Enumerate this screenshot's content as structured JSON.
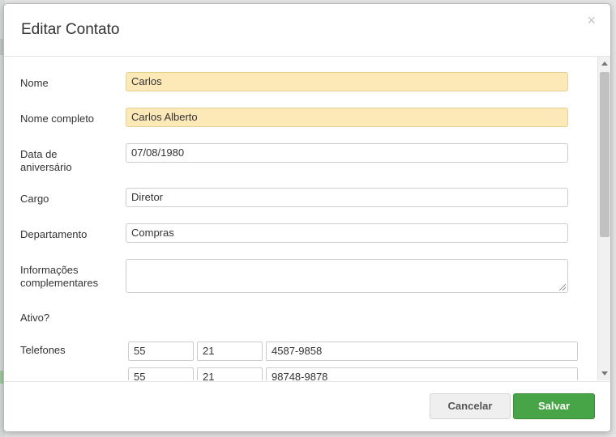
{
  "dialog": {
    "title": "Editar Contato",
    "close_glyph": "×"
  },
  "form": {
    "nome": {
      "label": "Nome",
      "value": "Carlos"
    },
    "nome_completo": {
      "label": "Nome completo",
      "value": "Carlos Alberto"
    },
    "aniversario": {
      "label_line1": "Data de",
      "label_line2": "aniversário",
      "value": "07/08/1980"
    },
    "cargo": {
      "label": "Cargo",
      "value": "Diretor"
    },
    "departamento": {
      "label": "Departamento",
      "value": "Compras"
    },
    "informacoes": {
      "label_line1": "Informações",
      "label_line2": "complementares",
      "value": ""
    },
    "ativo": {
      "label": "Ativo?"
    },
    "telefones": {
      "label": "Telefones",
      "rows": [
        {
          "country": "55",
          "area": "21",
          "number": "4587-9858"
        },
        {
          "country": "55",
          "area": "21",
          "number": "98748-9878"
        }
      ]
    }
  },
  "footer": {
    "cancel_label": "Cancelar",
    "save_label": "Salvar"
  },
  "colors": {
    "highlight_field": "#fde9b8",
    "save_button": "#47a447"
  }
}
